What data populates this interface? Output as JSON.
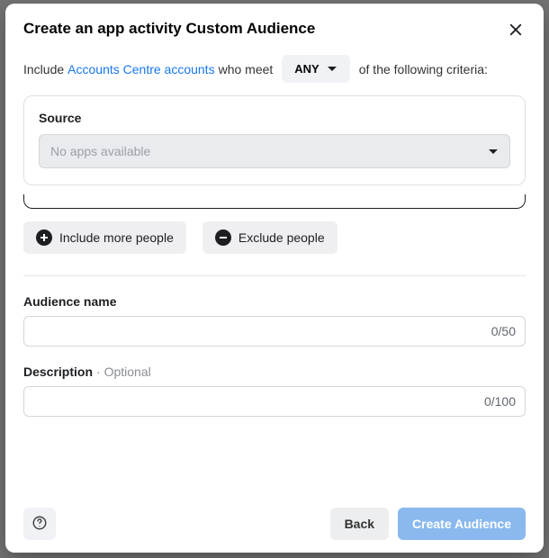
{
  "modal": {
    "title": "Create an app activity Custom Audience",
    "include_prefix": "Include",
    "accounts_link": "Accounts Centre accounts",
    "include_middle": "who meet",
    "any_label": "ANY",
    "include_suffix": "of the following criteria:"
  },
  "source": {
    "label": "Source",
    "placeholder": "No apps available"
  },
  "actions": {
    "include_more": "Include more people",
    "exclude": "Exclude people"
  },
  "fields": {
    "audience_name_label": "Audience name",
    "audience_name_counter": "0/50",
    "description_label": "Description",
    "description_optional": "· Optional",
    "description_counter": "0/100"
  },
  "footer": {
    "back": "Back",
    "create": "Create Audience"
  }
}
